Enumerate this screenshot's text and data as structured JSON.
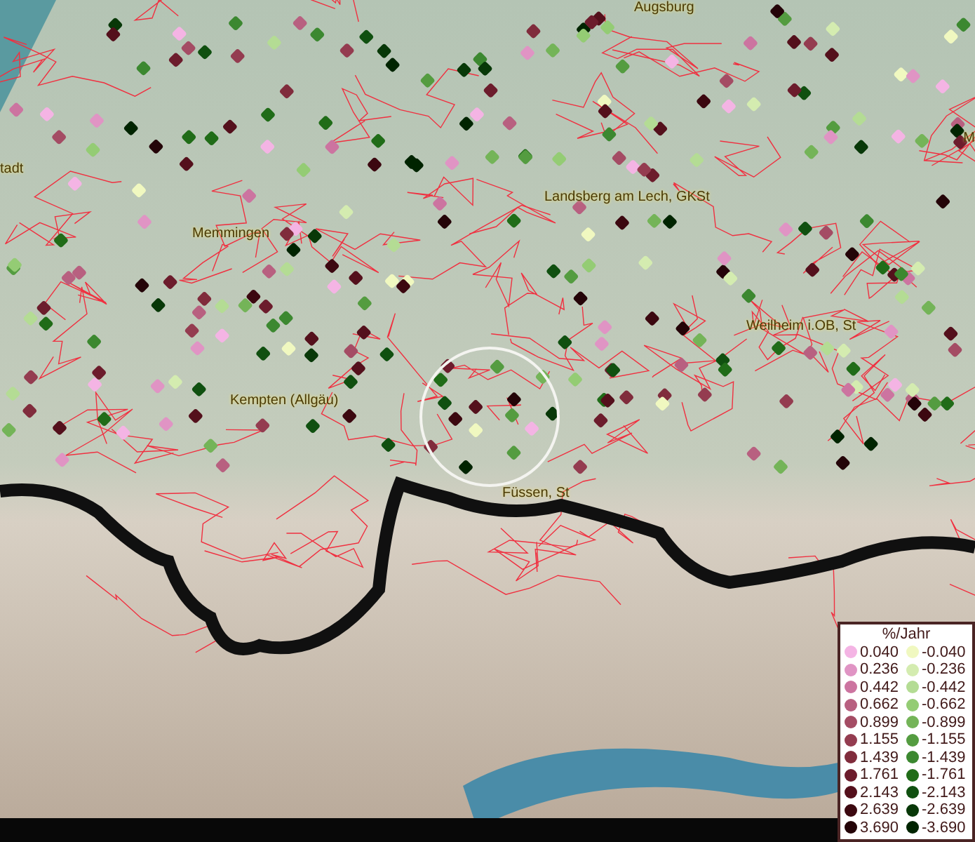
{
  "map": {
    "places": [
      {
        "name": "Augsburg"
      },
      {
        "name": "tadt"
      },
      {
        "name": "M"
      },
      {
        "name": "Memmingen"
      },
      {
        "name": "Landsberg am Lech, GKSt"
      },
      {
        "name": "Weilheim i.OB, St"
      },
      {
        "name": "Kempten (Allgäu)"
      },
      {
        "name": "Füssen, St"
      }
    ]
  },
  "legend": {
    "title": "%/Jahr",
    "entries": [
      [
        {
          "label": "0.040",
          "color": "#f4b4e4"
        },
        {
          "label": "-0.040",
          "color": "#f0f8c0"
        }
      ],
      [
        {
          "label": "0.236",
          "color": "#e094c4"
        },
        {
          "label": "-0.236",
          "color": "#d4ecb0"
        }
      ],
      [
        {
          "label": "0.442",
          "color": "#cc74a0"
        },
        {
          "label": "-0.442",
          "color": "#b4dc94"
        }
      ],
      [
        {
          "label": "0.662",
          "color": "#b86080"
        },
        {
          "label": "-0.662",
          "color": "#94cc74"
        }
      ],
      [
        {
          "label": "0.899",
          "color": "#a44c64"
        },
        {
          "label": "-0.899",
          "color": "#74b458"
        }
      ],
      [
        {
          "label": "1.155",
          "color": "#943c50"
        },
        {
          "label": "-1.155",
          "color": "#549c40"
        }
      ],
      [
        {
          "label": "1.439",
          "color": "#802c3c"
        },
        {
          "label": "-1.439",
          "color": "#3c8830"
        }
      ],
      [
        {
          "label": "1.761",
          "color": "#6c1c2c"
        },
        {
          "label": "-1.761",
          "color": "#206c18"
        }
      ],
      [
        {
          "label": "2.143",
          "color": "#54101c"
        },
        {
          "label": "-2.143",
          "color": "#105010"
        }
      ],
      [
        {
          "label": "2.639",
          "color": "#3c0810"
        },
        {
          "label": "-2.639",
          "color": "#083808"
        }
      ],
      [
        {
          "label": "3.690",
          "color": "#240408"
        },
        {
          "label": "-3.690",
          "color": "#002400"
        }
      ]
    ]
  }
}
